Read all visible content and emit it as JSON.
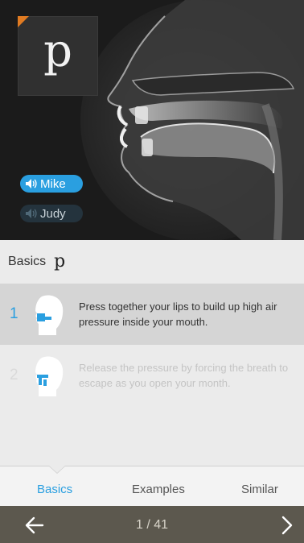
{
  "hero": {
    "phoneme": "p",
    "voices": [
      {
        "label": "Mike",
        "active": true
      },
      {
        "label": "Judy",
        "active": false
      }
    ]
  },
  "section": {
    "title": "Basics",
    "symbol": "p"
  },
  "steps": [
    {
      "number": "1",
      "text": "Press together your lips to build up high air pressure inside your mouth.",
      "active": true
    },
    {
      "number": "2",
      "text": "Release the pressure by forcing the breath to escape as you open your month.",
      "active": false
    }
  ],
  "tabs": [
    {
      "label": "Basics",
      "active": true
    },
    {
      "label": "Examples",
      "active": false
    },
    {
      "label": "Similar",
      "active": false
    }
  ],
  "pager": {
    "text": "1 / 41"
  },
  "colors": {
    "accent": "#2a9fe0",
    "corner": "#e07b22",
    "bottom_bar": "#5c584e"
  },
  "icons": {
    "voice": "speaker-icon",
    "prev": "arrow-left-icon",
    "next": "chevron-right-icon",
    "step": "head-profile-icon"
  }
}
